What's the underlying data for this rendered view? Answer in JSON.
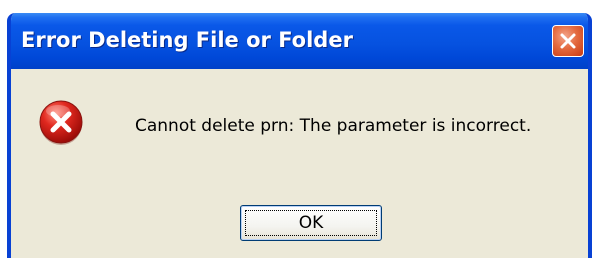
{
  "window": {
    "title": "Error Deleting File or Folder",
    "close_icon": "close-icon",
    "titlebar_color": "#0652e0",
    "close_button_color": "#e46a3f"
  },
  "dialog": {
    "icon": "error-icon",
    "icon_color": "#d8201c",
    "message": "Cannot delete prn: The parameter is incorrect.",
    "background_color": "#ece9d8"
  },
  "buttons": {
    "ok_label": "OK"
  }
}
